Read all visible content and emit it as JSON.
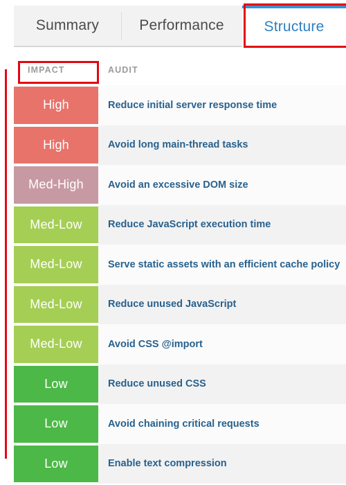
{
  "tabs": [
    {
      "label": "Summary",
      "active": false
    },
    {
      "label": "Performance",
      "active": false
    },
    {
      "label": "Structure",
      "active": true
    }
  ],
  "table": {
    "headers": {
      "impact": "IMPACT",
      "audit": "AUDIT"
    },
    "rows": [
      {
        "impact": "High",
        "audit": "Reduce initial server response time"
      },
      {
        "impact": "High",
        "audit": "Avoid long main-thread tasks"
      },
      {
        "impact": "Med-High",
        "audit": "Avoid an excessive DOM size"
      },
      {
        "impact": "Med-Low",
        "audit": "Reduce JavaScript execution time"
      },
      {
        "impact": "Med-Low",
        "audit": "Serve static assets with an efficient cache policy"
      },
      {
        "impact": "Med-Low",
        "audit": "Reduce unused JavaScript"
      },
      {
        "impact": "Med-Low",
        "audit": "Avoid CSS @import"
      },
      {
        "impact": "Low",
        "audit": "Reduce unused CSS"
      },
      {
        "impact": "Low",
        "audit": "Avoid chaining critical requests"
      },
      {
        "impact": "Low",
        "audit": "Enable text compression"
      }
    ]
  },
  "colors": {
    "impact_high": "#e8736a",
    "impact_med_high": "#c79aa3",
    "impact_med_low": "#a5ce55",
    "impact_low": "#4cb847",
    "tab_active_text": "#2e7fc0",
    "tab_active_border": "#3b90cf",
    "audit_text": "#28618d",
    "header_text": "#9b9b9b",
    "annotation": "#e30613",
    "row_bg": "#fbfbfb",
    "row_bg_alt": "#f2f2f2"
  },
  "annotations": [
    {
      "name": "structure-tab-highlight",
      "shape": "rectangle"
    },
    {
      "name": "impact-column-highlight",
      "shape": "rectangle"
    },
    {
      "name": "impact-column-bar",
      "shape": "vertical-line"
    }
  ]
}
